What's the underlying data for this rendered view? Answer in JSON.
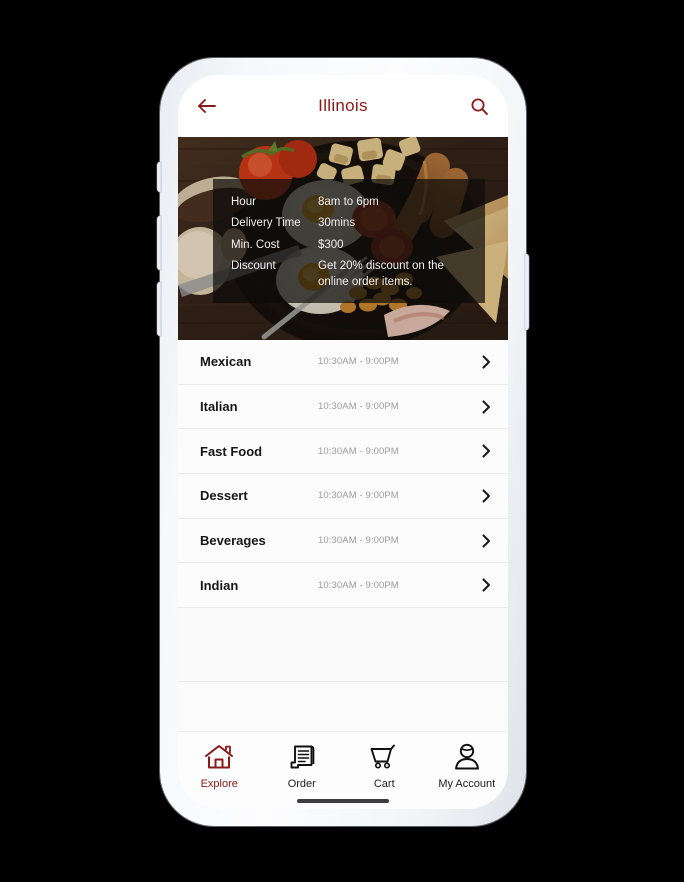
{
  "theme": {
    "accent": "#8a1a1a",
    "screen_bg": "#ffffff",
    "row_bg": "#fcfcfc",
    "muted_text": "#9b9b9b",
    "frame": "#f2f4f7"
  },
  "header": {
    "back_icon": "arrow-left-icon",
    "title": "Illinois",
    "search_icon": "search-icon"
  },
  "hero": {
    "image_alt": "breakfast skillet with eggs sausages mushrooms and tomato",
    "info": [
      {
        "label": "Hour",
        "value": "8am to 6pm"
      },
      {
        "label": "Delivery Time",
        "value": "30mins"
      },
      {
        "label": "Min. Cost",
        "value": "$300"
      },
      {
        "label": "Discount",
        "value": "Get 20% discount on the online order items."
      }
    ]
  },
  "categories": {
    "chevron_icon": "chevron-right-icon",
    "items": [
      {
        "name": "Mexican",
        "time": "10:30AM - 9:00PM"
      },
      {
        "name": "Italian",
        "time": "10:30AM - 9:00PM"
      },
      {
        "name": "Fast Food",
        "time": "10:30AM - 9:00PM"
      },
      {
        "name": "Dessert",
        "time": "10:30AM - 9:00PM"
      },
      {
        "name": "Beverages",
        "time": "10:30AM - 9:00PM"
      },
      {
        "name": "Indian",
        "time": "10:30AM - 9:00PM"
      }
    ]
  },
  "tab_bar": {
    "items": [
      {
        "label": "Explore",
        "icon": "home-icon",
        "active": true
      },
      {
        "label": "Order",
        "icon": "receipt-icon",
        "active": false
      },
      {
        "label": "Cart",
        "icon": "cart-icon",
        "active": false
      },
      {
        "label": "My Account",
        "icon": "user-icon",
        "active": false
      }
    ]
  }
}
